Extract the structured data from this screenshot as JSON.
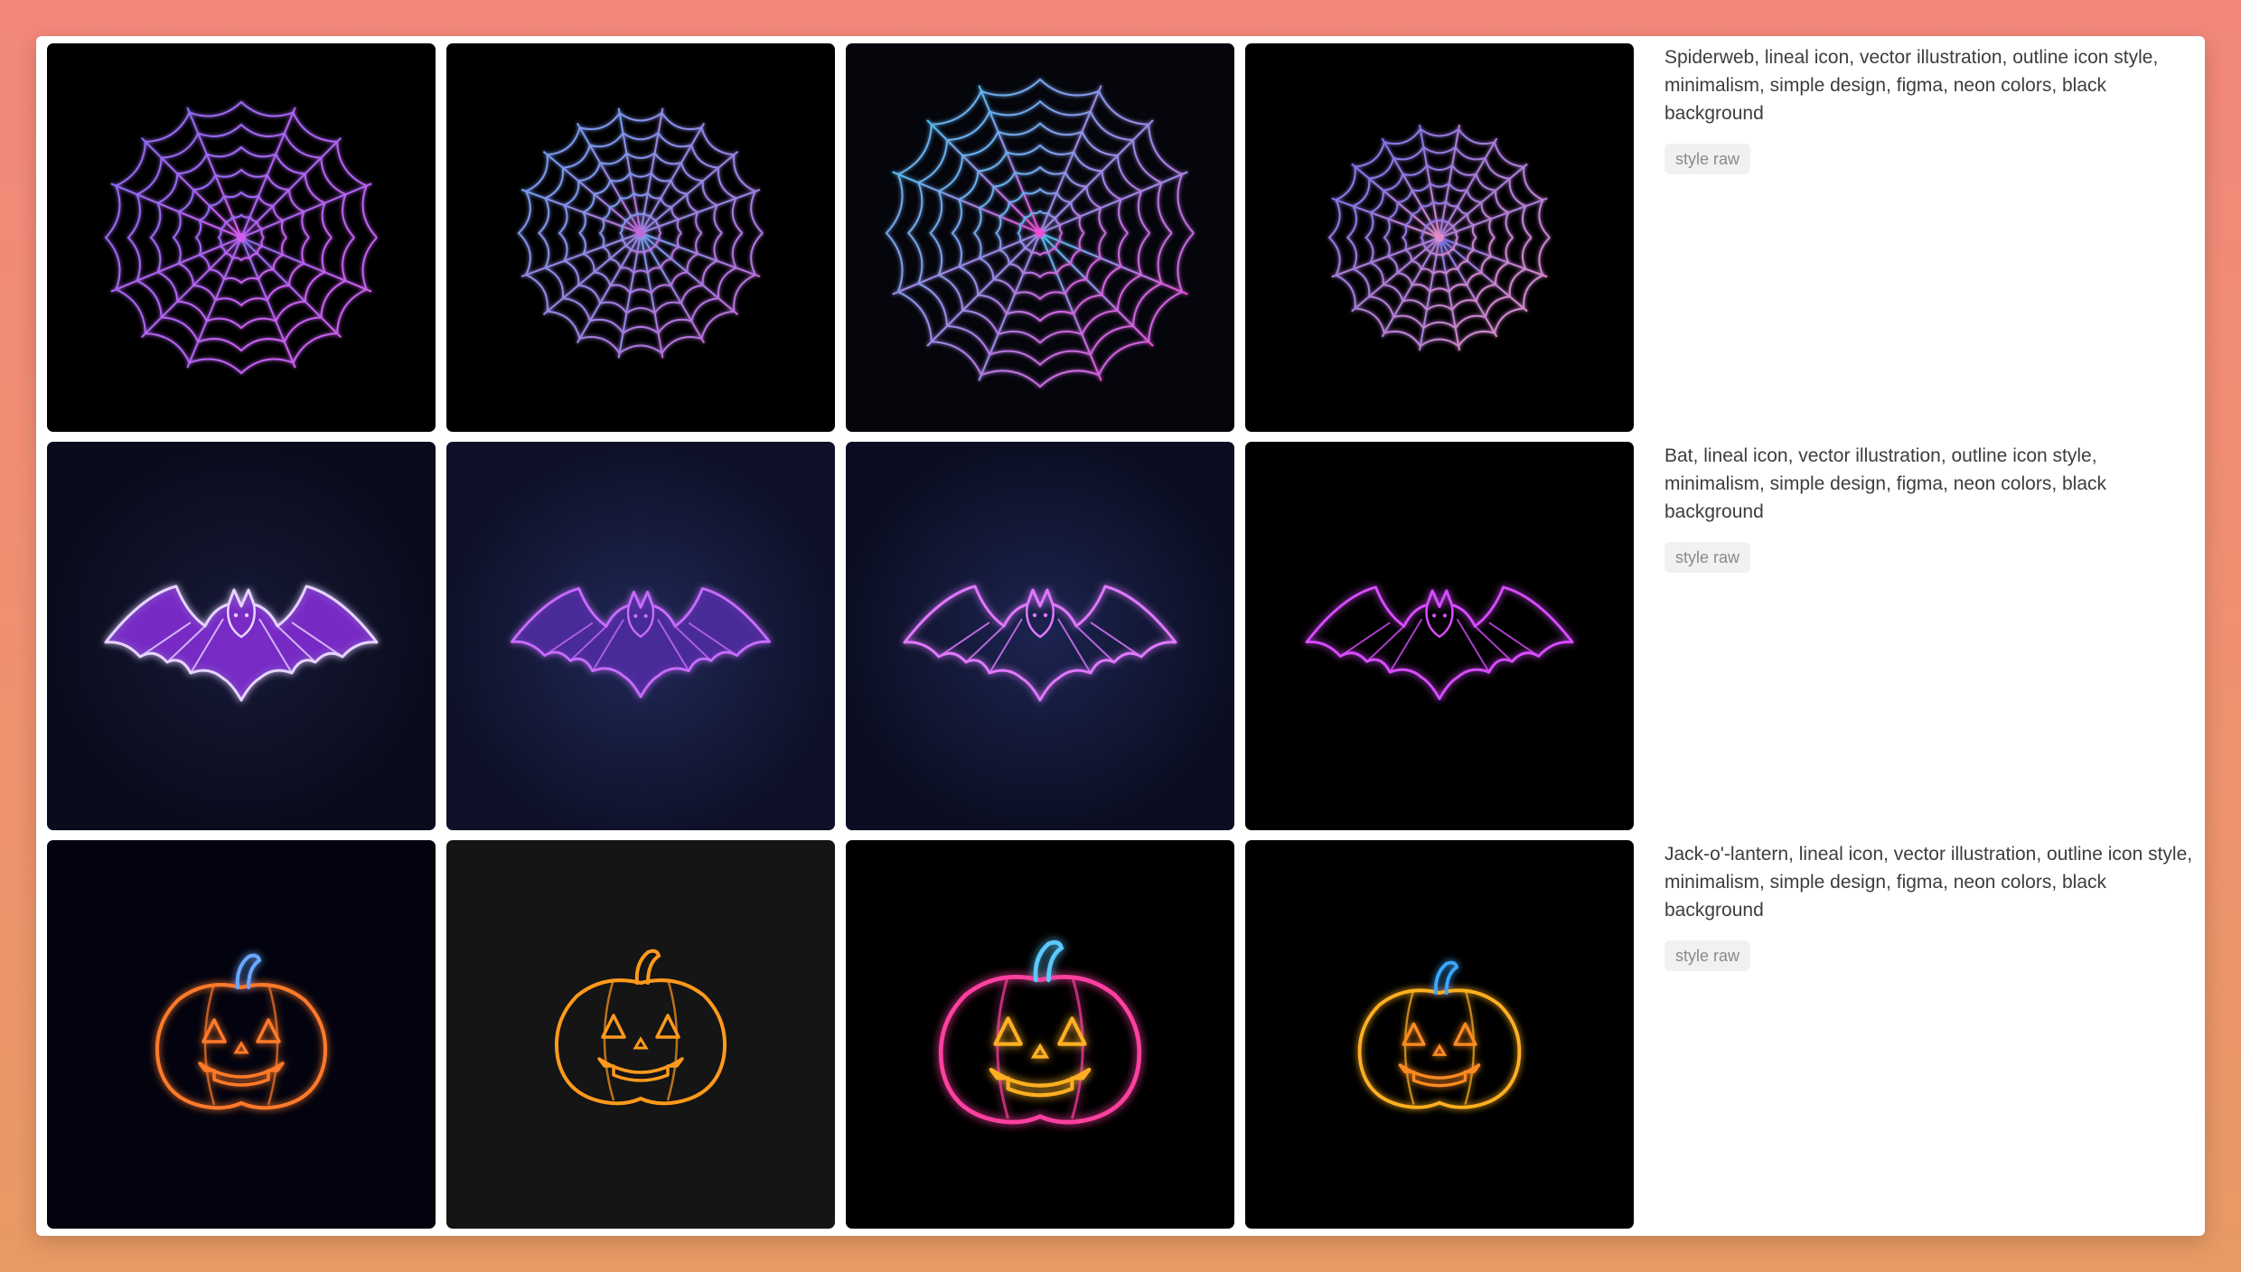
{
  "background": {
    "gradient_top": "#f2877a",
    "gradient_bottom": "#e79a63"
  },
  "rows": [
    {
      "subject": "spiderweb-icon",
      "prompt": "Spiderweb, lineal icon, vector illustration, outline icon style, minimalism, simple design, figma, neon colors, black background",
      "tag": "style raw"
    },
    {
      "subject": "bat-icon",
      "prompt": "Bat, lineal icon, vector illustration, outline icon style, minimalism, simple design, figma, neon colors, black background",
      "tag": "style raw"
    },
    {
      "subject": "jack-o-lantern-icon",
      "prompt": "Jack-o'-lantern, lineal icon, vector illustration, outline icon style, minimalism, simple design, figma, neon colors, black background",
      "tag": "style raw"
    }
  ]
}
